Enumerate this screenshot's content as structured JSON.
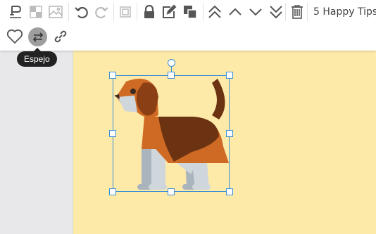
{
  "toolbar": {
    "tips_label": "5 Happy Tips",
    "row1_icons": [
      "paint-format-icon",
      "transparency-icon",
      "replace-image-icon",
      "undo-icon",
      "redo-icon",
      "crop-icon",
      "lock-icon",
      "edit-icon",
      "duplicate-icon",
      "move-top-icon",
      "move-up-icon",
      "move-down-icon",
      "move-bottom-icon",
      "delete-icon"
    ],
    "row2_icons": [
      "favorite-icon",
      "mirror-icon",
      "link-icon"
    ]
  },
  "tooltip": {
    "label": "Espejo"
  },
  "canvas": {
    "background": "#fdeaa9",
    "selected_element": "dog-image"
  },
  "colors": {
    "accent": "#3b8fd6",
    "icon": "#555555",
    "icon_disabled": "#bbbbbb",
    "tooltip_bg": "#222222"
  }
}
